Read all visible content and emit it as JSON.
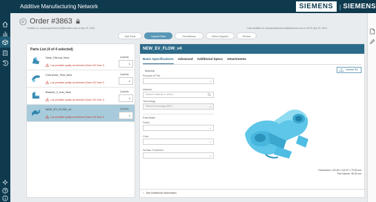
{
  "app": {
    "title": "Additive Manufacturing Network"
  },
  "brand": {
    "logo": "SIEMENS",
    "text": "SIEMENS"
  },
  "order": {
    "title": "Order #3863",
    "created": "Created on: companynetwork.net@siemens.com on Apr 19, 2024",
    "updated": "Last modified on companynetwork.net@siemens.com on 09:20, Apr 19, 2024"
  },
  "steps": [
    {
      "label": "Add Parts",
      "active": false
    },
    {
      "label": "Upload Parts",
      "active": true
    },
    {
      "label": "Set Address",
      "active": false
    },
    {
      "label": "Select Supplier",
      "active": false
    },
    {
      "label": "Review",
      "active": false
    }
  ],
  "parts_panel": {
    "title": "Parts List (4 of 4 selected)",
    "qty_label": "Quantity",
    "items": [
      {
        "name": "Gear_Shroud_New",
        "warning": "Low printable quality as detected (Score 2/5 View ?)",
        "qty": "1",
        "selected": false
      },
      {
        "name": "Connector_Test_New",
        "warning": "Low printable quality as detected (Score 2/5 View ?)",
        "qty": "1",
        "selected": false
      },
      {
        "name": "Bracket_2_test_New",
        "warning": "Low printable quality as detected (Score 2/5 View ?)",
        "qty": "1",
        "selected": false
      },
      {
        "name": "NEW_EV_FLOW_v4",
        "warning": "Low printable quality as detected (Score 2/5 View ?)",
        "qty": "1",
        "selected": true
      }
    ]
  },
  "detail": {
    "title": "NEW_EV_FLOW_v4",
    "tabs": [
      "Basic Specifications",
      "Advanced",
      "Additional Specs",
      "Attachments"
    ],
    "form": {
      "heading": "Material",
      "purpose_label": "Purpose of Part",
      "purpose_value": "",
      "material_label": "Material",
      "material_placeholder": "Search material or select",
      "technology_label": "Technology",
      "technology_value": "Select technology (MJF)",
      "post_section": "Post-finish",
      "finish_label": "Finish",
      "finish_value": "",
      "color_label": "Color",
      "color_value": "",
      "surface_label": "Surface Treatment",
      "surface_value": ""
    },
    "upload_label": "Upload 3D",
    "dimensions": "Dimensions: 120.45 x 120.97 x 75.30 mm",
    "part_volume": "Part Volume: 46.25 cm³",
    "additional_info": "See Additional Information"
  },
  "colors": {
    "topbar": "#0f3a4e",
    "accent": "#2c6a89",
    "step_active": "#5a97b7",
    "row_selected": "#a7cbdb",
    "warning": "#c0392b",
    "model": "#5ec6e8"
  },
  "icons": {
    "left_nav": [
      "home-icon",
      "chart-icon",
      "parts-icon",
      "building-icon",
      "history-icon",
      "settings-icon",
      "help-icon",
      "info-icon"
    ],
    "right_rail": [
      "document-icon",
      "edit-icon"
    ]
  }
}
